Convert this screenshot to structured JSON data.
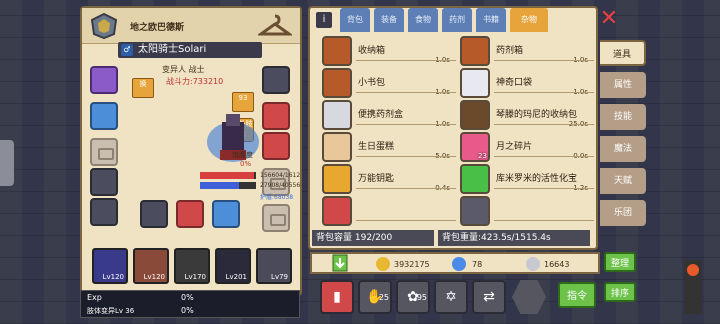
{
  "character": {
    "title": "地之欧巴德斯",
    "sex_symbol": "♂",
    "name": "太阳骑士Solari",
    "class_line": "变异人 战士",
    "power": "战斗力:733210",
    "tag_left": "换",
    "tag_right": "93",
    "extra_label": "额外肢体",
    "satiety_label": "饱腹度",
    "satiety_value": "0%",
    "hp_label": "HP",
    "hp_value": "156604/1612",
    "mp_label": "MP",
    "mp_value": "27908/40556",
    "armor_value": "护盾:68038",
    "hp_fraction": 0.97,
    "mp_fraction": 0.69,
    "pets": [
      {
        "level": "Lv120"
      },
      {
        "level": "Lv120"
      },
      {
        "level": "Lv170"
      },
      {
        "level": "Lv201"
      },
      {
        "level": "Lv79"
      }
    ]
  },
  "xp": {
    "label": "Exp",
    "exp_percent": "0%",
    "limb_label": "肢体变异Lv 36",
    "limb_percent": "0%"
  },
  "bag": {
    "tabs": [
      "背包",
      "装备",
      "食物",
      "药剂",
      "书籍",
      "杂物"
    ],
    "active_tab": "杂物",
    "items_left": [
      {
        "name": "收纳箱",
        "weight": "1.0s",
        "icon": "chest-icon",
        "color": "#b75a2a",
        "count": ""
      },
      {
        "name": "小书包",
        "weight": "1.0s",
        "icon": "backpack-icon",
        "color": "#b75a2a",
        "count": ""
      },
      {
        "name": "便携药剂盒",
        "weight": "1.0s",
        "icon": "medicine-box-icon",
        "color": "#d8d8e0",
        "count": ""
      },
      {
        "name": "生日蛋糕",
        "weight": "5.0s",
        "icon": "cake-icon",
        "color": "#e8c89a",
        "count": ""
      },
      {
        "name": "万能钥匙",
        "weight": "0.4s",
        "icon": "key-icon",
        "color": "#e8a830",
        "count": ""
      },
      {
        "name": "",
        "weight": "",
        "icon": "item-icon",
        "color": "#d04848",
        "count": ""
      }
    ],
    "items_right": [
      {
        "name": "药剂箱",
        "weight": "1.0s",
        "icon": "potion-chest-icon",
        "color": "#b75a2a",
        "count": ""
      },
      {
        "name": "神奇口袋",
        "weight": "1.0s",
        "icon": "magic-pouch-icon",
        "color": "#e8e8f0",
        "count": ""
      },
      {
        "name": "琴滕的玛尼的收纳包",
        "weight": "25.0s",
        "icon": "storage-bag-icon",
        "color": "#6a4a2a",
        "count": ""
      },
      {
        "name": "月之碎片",
        "weight": "0.0s",
        "icon": "moon-shard-icon",
        "color": "#e85a8a",
        "count": "23"
      },
      {
        "name": "库米罗米的活性化宝",
        "weight": "1.2s",
        "icon": "gem-icon",
        "color": "#48c048",
        "count": ""
      },
      {
        "name": "",
        "weight": "",
        "icon": "item-icon",
        "color": "#5a5a6a",
        "count": ""
      }
    ],
    "capacity": "背包容量 192/200",
    "weight": "背包重量:423.5s/1515.4s"
  },
  "currency": {
    "gold": "3932175",
    "diamond": "78",
    "silver": "16643"
  },
  "actions": {
    "count_1": "25",
    "count_2": "95",
    "command_label": "指令"
  },
  "right_tabs": [
    "道具",
    "属性",
    "技能",
    "魔法",
    "天赋",
    "乐团"
  ],
  "buttons": {
    "organize": "整理",
    "sort": "排序"
  }
}
